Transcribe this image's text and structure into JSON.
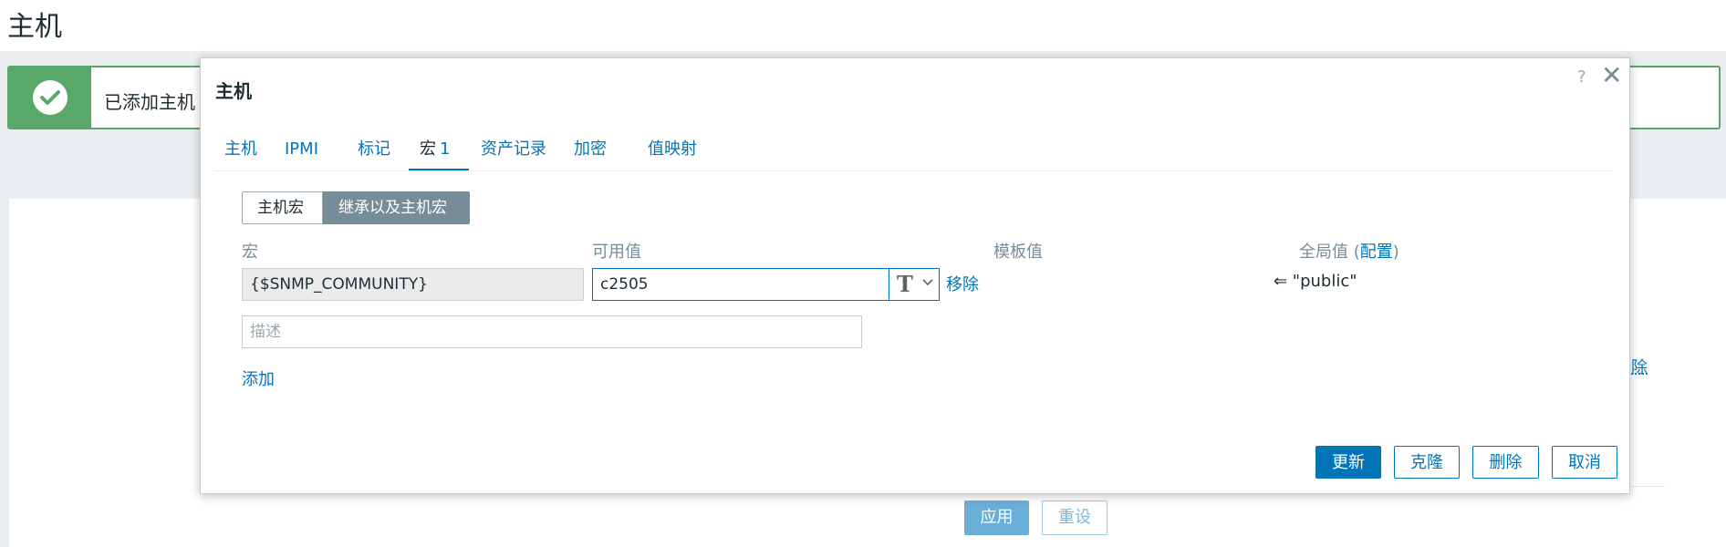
{
  "page": {
    "title": "主机",
    "success_message": "已添加主机",
    "bg_remove_link": "除",
    "bg_apply_label": "应用",
    "bg_reset_label": "重设"
  },
  "modal": {
    "title": "主机",
    "help_glyph": "?",
    "close_glyph": "✕",
    "tabs": [
      {
        "label": "主机"
      },
      {
        "label": "IPMI"
      },
      {
        "label": "标记"
      },
      {
        "label": "宏",
        "count": "1"
      },
      {
        "label": "资产记录"
      },
      {
        "label": "加密"
      },
      {
        "label": "值映射"
      }
    ],
    "segmented": {
      "host_macros": "主机宏",
      "inherited_macros": "继承以及主机宏"
    },
    "columns": {
      "macro": "宏",
      "effective_value": "可用值",
      "template_value": "模板值",
      "global_value": "全局值",
      "global_open": "(",
      "global_config": "配置",
      "global_close": ")"
    },
    "row": {
      "macro": "{$SNMP_COMMUNITY}",
      "value": "c2505",
      "type_glyph": "T",
      "remove_label": "移除",
      "global_value": "⇐ \"public\""
    },
    "description_placeholder": "描述",
    "add_label": "添加",
    "buttons": {
      "update": "更新",
      "clone": "克隆",
      "delete": "删除",
      "cancel": "取消"
    }
  }
}
